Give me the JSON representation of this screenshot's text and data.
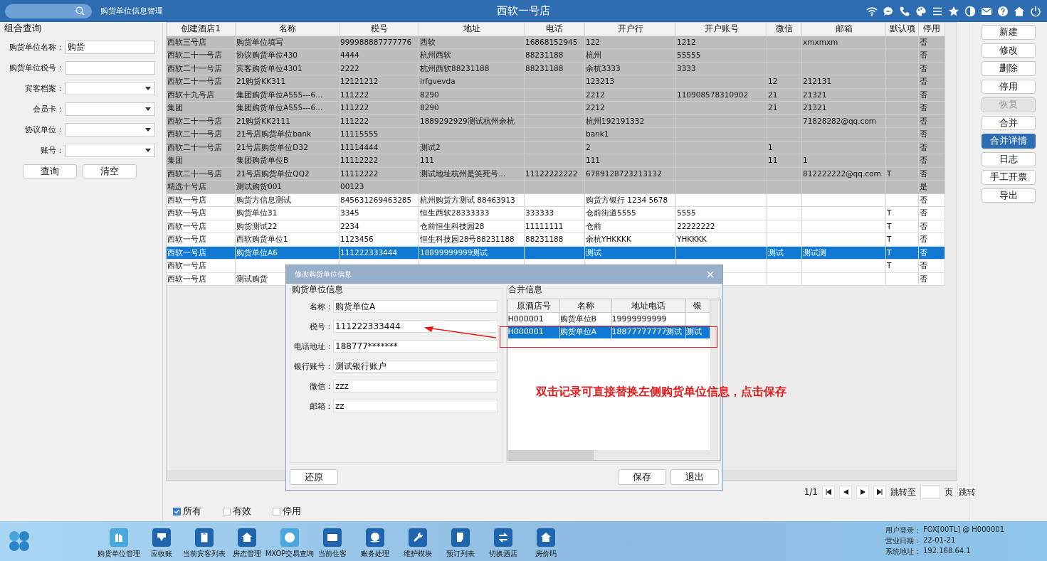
{
  "top_bar": {
    "module_title": "购货单位信息管理",
    "hotel_name": "西软一号店"
  },
  "query": {
    "title": "组合查询",
    "fields": [
      {
        "label": "购货单位名称：",
        "kind": "text",
        "value": "购货"
      },
      {
        "label": "购货单位税号：",
        "kind": "text"
      },
      {
        "label": "宾客档案：",
        "kind": "select"
      },
      {
        "label": "会员卡：",
        "kind": "select"
      },
      {
        "label": "协议单位：",
        "kind": "select"
      },
      {
        "label": "账号：",
        "kind": "select"
      }
    ],
    "buttons": [
      "查询",
      "清空"
    ]
  },
  "table": {
    "columns": [
      "创建酒店1",
      "名称",
      "税号",
      "地址",
      "电话",
      "开户行",
      "开户账号",
      "微信",
      "邮箱",
      "默认项",
      "停用"
    ],
    "rows": [
      {
        "greyed": true,
        "selected": false,
        "cells": [
          "西软三号店",
          "购货单位填写",
          "999988887777776",
          "西软",
          "16868152945",
          "122",
          "1212",
          null,
          "xmxmxm",
          null,
          "否"
        ]
      },
      {
        "greyed": true,
        "selected": false,
        "cells": [
          "西软二十一号店",
          "协议购货单位430",
          "4444",
          "杭州西软",
          "88231188",
          "杭州",
          "55555",
          null,
          null,
          null,
          "否"
        ]
      },
      {
        "greyed": true,
        "selected": false,
        "cells": [
          "西软二十一号店",
          "宾客购货单位4301",
          "2222",
          "杭州西软88231188",
          "88231188",
          "余杭3333",
          "3333",
          null,
          null,
          null,
          "否"
        ]
      },
      {
        "greyed": true,
        "selected": false,
        "cells": [
          "西软二十一号店",
          "21购货KK311",
          "12121212",
          "lrfgvevda",
          null,
          "123213",
          null,
          "12",
          "212131",
          null,
          "否"
        ]
      },
      {
        "greyed": true,
        "selected": false,
        "cells": [
          "西软十九号店",
          "集团购货单位A555---6...",
          "111222",
          "8290",
          null,
          "2212",
          "110908578310902",
          "21",
          "21321",
          null,
          "否"
        ]
      },
      {
        "greyed": true,
        "selected": false,
        "cells": [
          "集团",
          "集团购货单位A555---6...",
          "111222",
          "8290",
          null,
          "2212",
          null,
          "21",
          "21321",
          null,
          "否"
        ]
      },
      {
        "greyed": true,
        "selected": false,
        "cells": [
          "西软二十一号店",
          "21购货KK2111",
          "111222",
          "1889292929测试杭州余杭",
          null,
          "杭州192191332",
          null,
          null,
          "71828282@qq.com",
          null,
          "否"
        ]
      },
      {
        "greyed": true,
        "selected": false,
        "cells": [
          "西软二十一号店",
          "21号店购货单位bank",
          "11115555",
          null,
          null,
          "bank1",
          null,
          null,
          null,
          null,
          "否"
        ]
      },
      {
        "greyed": true,
        "selected": false,
        "cells": [
          "西软二十一号店",
          "21号店购货单位D32",
          "11114444",
          "测试2",
          null,
          "2",
          null,
          "1",
          null,
          null,
          "否"
        ]
      },
      {
        "greyed": true,
        "selected": false,
        "cells": [
          "集团",
          "集团购货单位B",
          "11112222",
          "111",
          null,
          "111",
          null,
          "11",
          "1",
          null,
          "否"
        ]
      },
      {
        "greyed": true,
        "selected": false,
        "cells": [
          "西软二十一号店",
          "21号店购货单位QQ2",
          "11112222",
          "测试地址杭州是笑死号...",
          "11122222222",
          "6789128723213132",
          null,
          null,
          "812222222@qq.com",
          "T",
          "否"
        ]
      },
      {
        "greyed": true,
        "selected": false,
        "cells": [
          "精选十号店",
          "测试购货001",
          "00123",
          null,
          null,
          null,
          null,
          null,
          null,
          null,
          "是"
        ]
      },
      {
        "greyed": false,
        "selected": false,
        "cells": [
          "西软一号店",
          "购货方信息测试",
          "845631269463285",
          "杭州购货方测试 88463913",
          null,
          "购货方银行 1234 5678",
          null,
          null,
          null,
          null,
          "否"
        ]
      },
      {
        "greyed": false,
        "selected": false,
        "cells": [
          "西软一号店",
          "购货单位31",
          "3345",
          "恒生西软28333333",
          "333333",
          "仓前街道5555",
          "5555",
          null,
          null,
          "T",
          "否"
        ]
      },
      {
        "greyed": false,
        "selected": false,
        "cells": [
          "西软一号店",
          "购货测试22",
          "2234",
          "仓前恒生科技园28",
          "11111111",
          "仓前",
          "22222222",
          null,
          null,
          "T",
          "否"
        ]
      },
      {
        "greyed": false,
        "selected": false,
        "cells": [
          "西软一号店",
          "西软购货单位1",
          "1123456",
          "恒生科技园28号88231188",
          "88231188",
          "余杭YHKKKK",
          "YHKKKK",
          null,
          null,
          "T",
          "否"
        ]
      },
      {
        "greyed": false,
        "selected": true,
        "cells": [
          "西软一号店",
          "购货单位A6",
          "111222333444",
          "18899999999测试",
          null,
          "测试",
          null,
          "测试",
          "测试测",
          "T",
          "否"
        ]
      },
      {
        "greyed": false,
        "selected": false,
        "cells": [
          "西软一号店",
          null,
          null,
          null,
          null,
          null,
          null,
          null,
          null,
          "T",
          "否"
        ]
      },
      {
        "greyed": false,
        "selected": false,
        "cells": [
          "西软一号店",
          "测试购货",
          null,
          null,
          null,
          null,
          null,
          null,
          null,
          null,
          "否"
        ]
      }
    ]
  },
  "actions": [
    {
      "label": "新建",
      "disabled": false,
      "selected": false
    },
    {
      "label": "修改",
      "disabled": false,
      "selected": false
    },
    {
      "label": "删除",
      "disabled": false,
      "selected": false
    },
    {
      "label": "停用",
      "disabled": false,
      "selected": false
    },
    {
      "label": "恢复",
      "disabled": true,
      "selected": false
    },
    {
      "label": "合并",
      "disabled": false,
      "selected": false
    },
    {
      "label": "合并详情",
      "disabled": false,
      "selected": true
    },
    {
      "label": "日志",
      "disabled": false,
      "selected": false
    },
    {
      "label": "手工开票",
      "disabled": false,
      "selected": false
    },
    {
      "label": "导出",
      "disabled": false,
      "selected": false
    }
  ],
  "pager": {
    "page": "1/1",
    "goto_label": "跳转至",
    "page_unit": "页",
    "goto_button": "跳转"
  },
  "filters": [
    {
      "label": "所有",
      "checked": true
    },
    {
      "label": "有效",
      "checked": false
    },
    {
      "label": "停用",
      "checked": false
    }
  ],
  "dialog": {
    "title": "修改购货单位信息",
    "left_group": {
      "title": "购货单位信息",
      "fields": [
        {
          "label": "名称：",
          "value": "购货单位A"
        },
        {
          "label": "税号：",
          "value": "111222333444"
        },
        {
          "label": "电话地址：",
          "value": "188777*******"
        },
        {
          "label": "银行账号：",
          "value": "测试银行账户"
        },
        {
          "label": "微信：",
          "value": "zzz"
        },
        {
          "label": "邮箱：",
          "value": "zz"
        }
      ]
    },
    "right_group": {
      "title": "合并信息",
      "columns": [
        "原酒店号",
        "名称",
        "地址电话",
        "银"
      ],
      "rows": [
        {
          "selected": false,
          "cells": [
            "H000001",
            "购货单位B",
            "19999999999",
            null
          ]
        },
        {
          "selected": true,
          "cells": [
            "H000001",
            "购货单位A",
            "18877777777测试",
            "测试"
          ]
        }
      ]
    },
    "annotation": "双击记录可直接替换左侧购货单位信息，点击保存",
    "buttons_left": [
      "还原"
    ],
    "buttons_right": [
      "保存",
      "退出"
    ]
  },
  "taskbar": {
    "items": [
      {
        "label": "购货单位管理",
        "kind": "building"
      },
      {
        "label": "应收账",
        "kind": "down"
      },
      {
        "label": "当前宾客列表",
        "kind": "badge"
      },
      {
        "label": "房态管理",
        "kind": "house"
      },
      {
        "label": "MXOP交易查询",
        "kind": "exchange"
      },
      {
        "label": "当前住客",
        "kind": "card"
      },
      {
        "label": "账务处理",
        "kind": "coin"
      },
      {
        "label": "维护模块",
        "kind": "wrench"
      },
      {
        "label": "预订列表",
        "kind": "doc"
      },
      {
        "label": "切换酒店",
        "kind": "swap"
      },
      {
        "label": "房价码",
        "kind": "house"
      }
    ],
    "status": [
      {
        "label": "用户登录：",
        "value": "FOX[00TL] @ H000001"
      },
      {
        "label": "营业日期：",
        "value": "22-01-21"
      },
      {
        "label": "系统地址：",
        "value": "192.168.64.1"
      }
    ]
  }
}
